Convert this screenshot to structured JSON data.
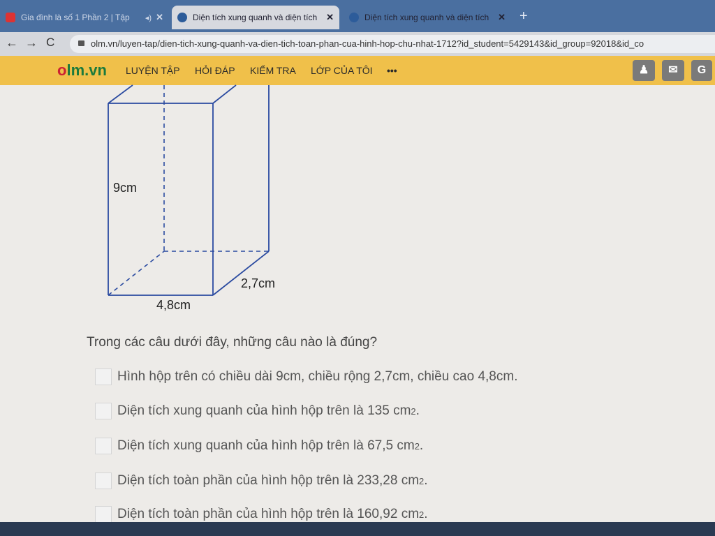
{
  "tabs": [
    {
      "title": "Gia đình là số 1 Phần 2 | Tập"
    },
    {
      "title": "Diện tích xung quanh và diện tích"
    },
    {
      "title": "Diện tích xung quanh và diện tích"
    }
  ],
  "address": {
    "url": "olm.vn/luyen-tap/dien-tich-xung-quanh-va-dien-tich-toan-phan-cua-hinh-hop-chu-nhat-1712?id_student=5429143&id_group=92018&id_co"
  },
  "site": {
    "logo_a": "o",
    "logo_b": "lm",
    "logo_c": ".vn",
    "menu": [
      "LUYỆN TẬP",
      "HỎI ĐÁP",
      "KIỂM TRA",
      "LỚP CỦA TÔI",
      "•••"
    ]
  },
  "figure": {
    "height_label": "9cm",
    "width_label": "2,7cm",
    "length_label": "4,8cm"
  },
  "question": {
    "text": "Trong các câu dưới đây, những câu nào là đúng?"
  },
  "options": [
    {
      "text": "Hình hộp trên có chiều dài 9cm, chiều rộng 2,7cm, chiều cao 4,8cm.",
      "checked": false
    },
    {
      "text": "Diện tích xung quanh của hình hộp trên là 135 cm",
      "sup": "2",
      "end": ".",
      "checked": false
    },
    {
      "text": "Diện tích xung quanh của hình hộp trên là 67,5 cm",
      "sup": "2",
      "end": ".",
      "checked": false
    },
    {
      "text": "Diện tích toàn phần của hình hộp trên là 233,28 cm",
      "sup": "2",
      "end": ".",
      "checked": false
    },
    {
      "text": "Diện tích toàn phần của hình hộp trên là 160,92 cm",
      "sup": "2",
      "end": ".",
      "checked": false
    }
  ],
  "colors": {
    "tabbar": "#4a6fa0",
    "header": "#f0c04a",
    "logo_red": "#cc2233",
    "logo_green": "#1c7a3c"
  }
}
